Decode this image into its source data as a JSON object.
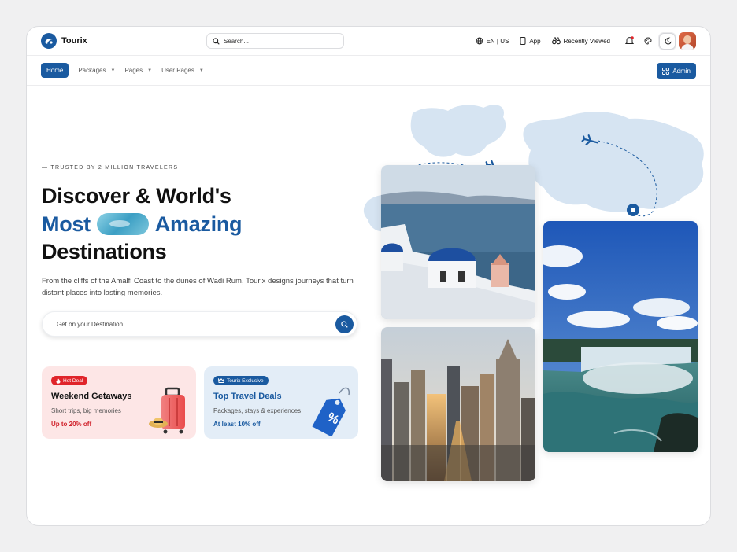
{
  "brand": {
    "name": "Tourix"
  },
  "search": {
    "placeholder": "Search..."
  },
  "top_actions": {
    "language": "EN | US",
    "app": "App",
    "recently_viewed": "Recently Viewed"
  },
  "nav": {
    "items": [
      {
        "label": "Home",
        "active": true
      },
      {
        "label": "Packages",
        "dropdown": true
      },
      {
        "label": "Pages",
        "dropdown": true
      },
      {
        "label": "User Pages",
        "dropdown": true
      }
    ],
    "admin_label": "Admin"
  },
  "hero": {
    "eyebrow": "— TRUSTED BY 2 MILLION TRAVELERS",
    "line1": "Discover & World's",
    "line2a": "Most",
    "line2b": "Amazing",
    "line3": "Destinations",
    "description": "From the cliffs of the Amalfi Coast to the dunes of Wadi Rum, Tourix designs journeys that turn distant places into lasting memories.",
    "destination_placeholder": "Get on your Destination"
  },
  "cards": [
    {
      "badge": "Hot Deal",
      "title": "Weekend Getaways",
      "subtitle": "Short trips, big memories",
      "deal": "Up to 20% off"
    },
    {
      "badge": "Tourix Exclusive",
      "title": "Top Travel Deals",
      "subtitle": "Packages, stays & experiences",
      "deal": "At least 10% off"
    }
  ],
  "colors": {
    "brand": "#1a5aa0",
    "hot_deal": "#e0242a",
    "pink_card": "#fde6e6",
    "blue_card": "#e3edf7",
    "map": "#d6e4f2"
  },
  "icons": [
    "logo-icon",
    "search-icon",
    "globe-icon",
    "phone-icon",
    "binoculars-icon",
    "bell-icon",
    "palette-icon",
    "moon-icon",
    "grid-icon",
    "plane-icon",
    "location-pin-icon",
    "fire-icon",
    "crown-icon",
    "suitcase-icon",
    "tag-icon"
  ]
}
